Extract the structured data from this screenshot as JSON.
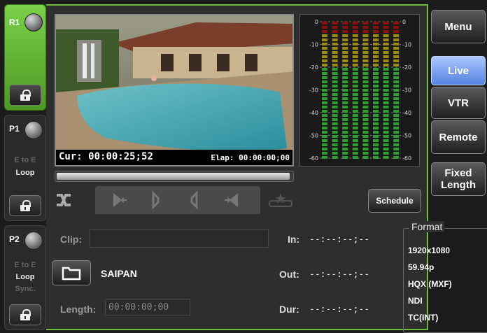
{
  "channels": {
    "r1": {
      "name": "R1"
    },
    "p1": {
      "name": "P1",
      "opt1": "E to E",
      "opt2": "Loop"
    },
    "p2": {
      "name": "P2",
      "opt1": "E to E",
      "opt2": "Loop",
      "opt3": "Sync."
    }
  },
  "player": {
    "cur_label": "Cur:",
    "cur_tc": "00:00:25;52",
    "elap_label": "Elap:",
    "elap_tc": "00:00:00;00",
    "progress_fraction": 0.99
  },
  "meter": {
    "scale_left": [
      "0",
      "-10",
      "-20",
      "-30",
      "-40",
      "-50",
      "-60"
    ],
    "scale_right": [
      "0",
      "-10",
      "-20",
      "-30",
      "-40",
      "-50",
      "-60"
    ],
    "channel_count": 8,
    "colors": {
      "peak": "#8b1010",
      "warn": "#9b8b10",
      "ok": "#2fa02f",
      "bg": "#1a1a1a"
    }
  },
  "transport": {
    "buttons": [
      "shuffle-icon",
      "go-to-start-icon",
      "step-back-icon",
      "step-forward-icon",
      "go-to-end-icon",
      "marker-icon"
    ]
  },
  "schedule_label": "Schedule",
  "clip": {
    "clip_label": "Clip:",
    "clip_value": "",
    "name": "SAIPAN",
    "length_label": "Length:",
    "length_value": "00:00:00;00"
  },
  "in_out": {
    "in_label": "In:",
    "in_value": "--:--:--;--",
    "out_label": "Out:",
    "out_value": "--:--:--;--",
    "dur_label": "Dur:",
    "dur_value": "--:--:--;--"
  },
  "format": {
    "title": "Format",
    "items": [
      "1920x1080",
      "59.94p",
      "HQX (MXF)",
      "NDI",
      "TC(INT)"
    ]
  },
  "right_menu": {
    "menu": "Menu",
    "live": "Live",
    "vtr": "VTR",
    "remote": "Remote",
    "fixed_line1": "Fixed",
    "fixed_line2": "Length"
  },
  "accent_color": "#6fbb3d",
  "active_color": "#5682e0"
}
